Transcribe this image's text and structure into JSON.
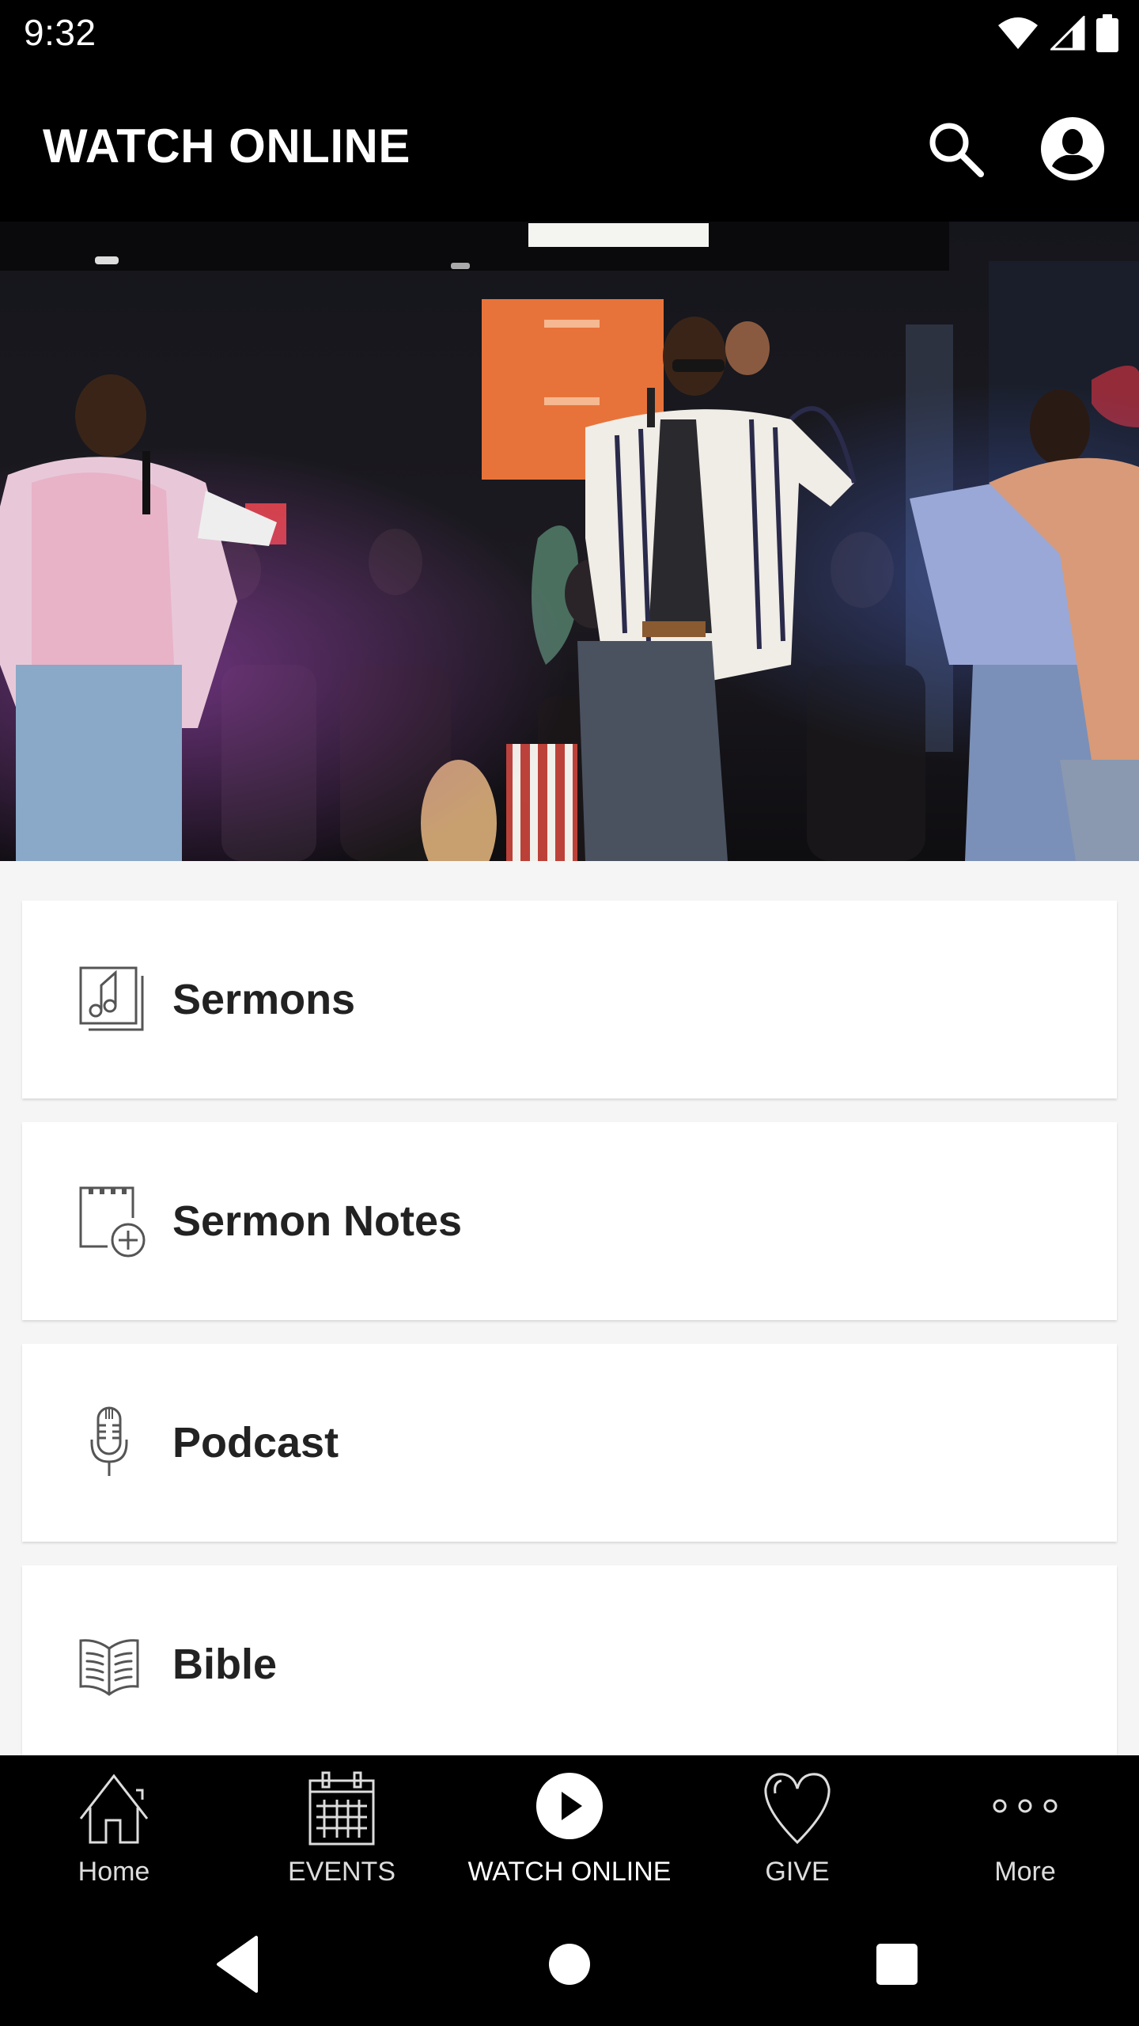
{
  "status_bar": {
    "time": "9:32",
    "icons": [
      "wifi-icon",
      "signal-icon",
      "battery-icon"
    ]
  },
  "app_bar": {
    "title": "WATCH ONLINE",
    "actions": [
      {
        "name": "search",
        "icon": "search-icon"
      },
      {
        "name": "profile",
        "icon": "account-circle-icon"
      }
    ]
  },
  "hero": {
    "description": "Worship team performing on stage with microphones in front of a crowd"
  },
  "menu": {
    "items": [
      {
        "label": "Sermons",
        "icon": "music-library-icon"
      },
      {
        "label": "Sermon Notes",
        "icon": "notepad-add-icon"
      },
      {
        "label": "Podcast",
        "icon": "microphone-icon"
      },
      {
        "label": "Bible",
        "icon": "open-book-icon"
      }
    ]
  },
  "bottom_nav": {
    "items": [
      {
        "label": "Home",
        "icon": "home-icon",
        "active": false
      },
      {
        "label": "EVENTS",
        "icon": "calendar-icon",
        "active": false
      },
      {
        "label": "WATCH ONLINE",
        "icon": "play-circle-icon",
        "active": true
      },
      {
        "label": "GIVE",
        "icon": "heart-icon",
        "active": false
      },
      {
        "label": "More",
        "icon": "more-dots-icon",
        "active": false
      }
    ]
  },
  "system_nav": {
    "buttons": [
      "back",
      "home",
      "recents"
    ]
  },
  "colors": {
    "app_bar_bg": "#000000",
    "content_bg": "#f5f5f5",
    "card_bg": "#ffffff",
    "card_text": "#222222",
    "icon_stroke": "#555555",
    "nav_text": "#dddddd"
  }
}
